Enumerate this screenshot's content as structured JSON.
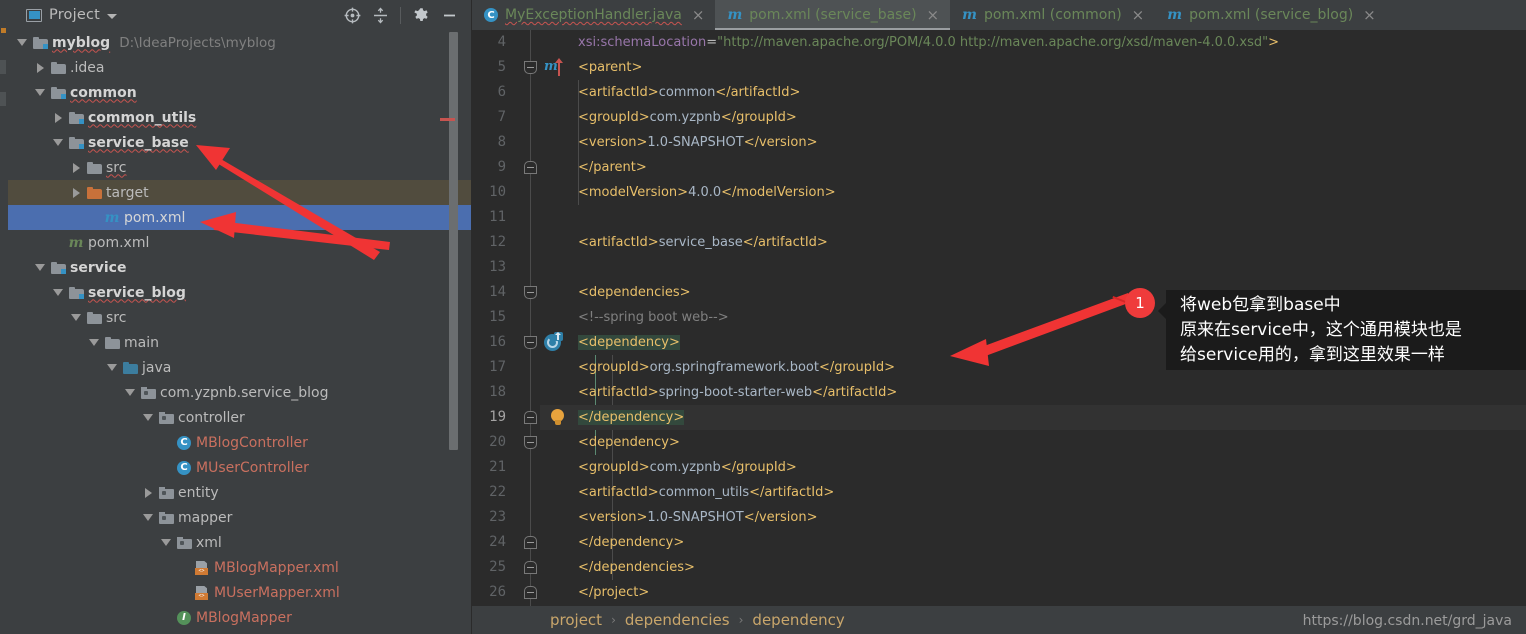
{
  "window": {
    "watermark": "https://blog.csdn.net/grd_java"
  },
  "project_panel": {
    "title": "Project",
    "icons": {
      "project": "project-window-icon",
      "chevron": "chevron-down-icon",
      "locate": "locate-target-icon",
      "collapse_all": "collapse-all-icon",
      "settings": "gear-icon",
      "minimize": "minimize-icon"
    },
    "tree": [
      {
        "label": "myblog",
        "sub": "D:\\IdeaProjects\\myblog",
        "indent": 0,
        "twisty": "down",
        "icon": "folder-module",
        "bold": true,
        "squiggle": true
      },
      {
        "label": ".idea",
        "sub": "",
        "indent": 1,
        "twisty": "right",
        "icon": "folder-plain",
        "bold": false,
        "squiggle": false
      },
      {
        "label": "common",
        "sub": "",
        "indent": 1,
        "twisty": "down",
        "icon": "folder-module",
        "bold": true,
        "squiggle": true
      },
      {
        "label": "common_utils",
        "sub": "",
        "indent": 2,
        "twisty": "right",
        "icon": "folder-module",
        "bold": true,
        "squiggle": true
      },
      {
        "label": "service_base",
        "sub": "",
        "indent": 2,
        "twisty": "down",
        "icon": "folder-module",
        "bold": true,
        "squiggle": true
      },
      {
        "label": "src",
        "sub": "",
        "indent": 3,
        "twisty": "right",
        "icon": "folder-plain",
        "bold": false,
        "squiggle": true
      },
      {
        "label": "target",
        "sub": "",
        "indent": 3,
        "twisty": "right",
        "icon": "folder-orange",
        "bold": false,
        "squiggle": false,
        "state": "excluded"
      },
      {
        "label": "pom.xml",
        "sub": "",
        "indent": 4,
        "twisty": "none",
        "icon": "maven-blue",
        "bold": false,
        "squiggle": false,
        "state": "selected"
      },
      {
        "label": "pom.xml",
        "sub": "",
        "indent": 2,
        "twisty": "none",
        "icon": "maven-green",
        "bold": false,
        "squiggle": false
      },
      {
        "label": "service",
        "sub": "",
        "indent": 1,
        "twisty": "down",
        "icon": "folder-module",
        "bold": true,
        "squiggle": false
      },
      {
        "label": "service_blog",
        "sub": "",
        "indent": 2,
        "twisty": "down",
        "icon": "folder-module",
        "bold": true,
        "squiggle": true
      },
      {
        "label": "src",
        "sub": "",
        "indent": 3,
        "twisty": "down",
        "icon": "folder-plain",
        "bold": false,
        "squiggle": false
      },
      {
        "label": "main",
        "sub": "",
        "indent": 4,
        "twisty": "down",
        "icon": "folder-plain",
        "bold": false,
        "squiggle": false
      },
      {
        "label": "java",
        "sub": "",
        "indent": 5,
        "twisty": "down",
        "icon": "folder-blue",
        "bold": false,
        "squiggle": false
      },
      {
        "label": "com.yzpnb.service_blog",
        "sub": "",
        "indent": 6,
        "twisty": "down",
        "icon": "package",
        "bold": false,
        "squiggle": false
      },
      {
        "label": "controller",
        "sub": "",
        "indent": 7,
        "twisty": "down",
        "icon": "package",
        "bold": false,
        "squiggle": false
      },
      {
        "label": "MBlogController",
        "sub": "",
        "indent": 8,
        "twisty": "none",
        "icon": "class",
        "bold": false,
        "squiggle": false,
        "state": "modified"
      },
      {
        "label": "MUserController",
        "sub": "",
        "indent": 8,
        "twisty": "none",
        "icon": "class",
        "bold": false,
        "squiggle": false,
        "state": "modified"
      },
      {
        "label": "entity",
        "sub": "",
        "indent": 7,
        "twisty": "right",
        "icon": "package",
        "bold": false,
        "squiggle": false
      },
      {
        "label": "mapper",
        "sub": "",
        "indent": 7,
        "twisty": "down",
        "icon": "package",
        "bold": false,
        "squiggle": false
      },
      {
        "label": "xml",
        "sub": "",
        "indent": 8,
        "twisty": "down",
        "icon": "package",
        "bold": false,
        "squiggle": false
      },
      {
        "label": "MBlogMapper.xml",
        "sub": "",
        "indent": 9,
        "twisty": "none",
        "icon": "xml-file",
        "bold": false,
        "squiggle": false,
        "state": "modified"
      },
      {
        "label": "MUserMapper.xml",
        "sub": "",
        "indent": 9,
        "twisty": "none",
        "icon": "xml-file",
        "bold": false,
        "squiggle": false,
        "state": "modified"
      },
      {
        "label": "MBlogMapper",
        "sub": "",
        "indent": 8,
        "twisty": "none",
        "icon": "interface",
        "bold": false,
        "squiggle": false,
        "state": "modified"
      }
    ]
  },
  "editor": {
    "tabs": [
      {
        "label": "MyExceptionHandler.java",
        "icon": "class",
        "active": false,
        "squiggle": true
      },
      {
        "label": "pom.xml (service_base)",
        "icon": "maven",
        "active": true,
        "squiggle": false
      },
      {
        "label": "pom.xml (common)",
        "icon": "maven",
        "active": false,
        "squiggle": false
      },
      {
        "label": "pom.xml (service_blog)",
        "icon": "maven",
        "active": false,
        "squiggle": false
      }
    ],
    "close_glyph": "×",
    "lines": [
      {
        "n": 4,
        "indent": 0,
        "fold": "",
        "current": false,
        "tokens": [
          {
            "t": "        ",
            "c": "txt"
          },
          {
            "t": "xsi:schemaLocation",
            "c": "attr"
          },
          {
            "t": "=",
            "c": "at"
          },
          {
            "t": "\"http://maven.apache.org/POM/4.0.0 http://maven.apache.org/xsd/maven-4.0.0.xsd\"",
            "c": "str"
          },
          {
            "t": ">",
            "c": "tg"
          }
        ]
      },
      {
        "n": 5,
        "indent": 0,
        "fold": "open",
        "current": false,
        "gutter": "maven-import",
        "tokens": [
          {
            "t": "    ",
            "c": "txt"
          },
          {
            "t": "<parent>",
            "c": "tg"
          }
        ]
      },
      {
        "n": 6,
        "indent": 0,
        "fold": "",
        "current": false,
        "tokens": [
          {
            "t": "        ",
            "c": "txt"
          },
          {
            "t": "<artifactId>",
            "c": "tg"
          },
          {
            "t": "common",
            "c": "txt"
          },
          {
            "t": "</artifactId>",
            "c": "tg"
          }
        ]
      },
      {
        "n": 7,
        "indent": 0,
        "fold": "",
        "current": false,
        "tokens": [
          {
            "t": "        ",
            "c": "txt"
          },
          {
            "t": "<groupId>",
            "c": "tg"
          },
          {
            "t": "com.yzpnb",
            "c": "txt"
          },
          {
            "t": "</groupId>",
            "c": "tg"
          }
        ]
      },
      {
        "n": 8,
        "indent": 0,
        "fold": "",
        "current": false,
        "tokens": [
          {
            "t": "        ",
            "c": "txt"
          },
          {
            "t": "<version>",
            "c": "tg"
          },
          {
            "t": "1.0-SNAPSHOT",
            "c": "txt"
          },
          {
            "t": "</version>",
            "c": "tg"
          }
        ]
      },
      {
        "n": 9,
        "indent": 0,
        "fold": "close",
        "current": false,
        "tokens": [
          {
            "t": "    ",
            "c": "txt"
          },
          {
            "t": "</parent>",
            "c": "tg"
          }
        ]
      },
      {
        "n": 10,
        "indent": 0,
        "fold": "",
        "current": false,
        "tokens": [
          {
            "t": "    ",
            "c": "txt"
          },
          {
            "t": "<modelVersion>",
            "c": "tg"
          },
          {
            "t": "4.0.0",
            "c": "txt"
          },
          {
            "t": "</modelVersion>",
            "c": "tg"
          }
        ]
      },
      {
        "n": 11,
        "indent": 0,
        "fold": "",
        "current": false,
        "tokens": []
      },
      {
        "n": 12,
        "indent": 0,
        "fold": "",
        "current": false,
        "tokens": [
          {
            "t": "    ",
            "c": "txt"
          },
          {
            "t": "<artifactId>",
            "c": "tg"
          },
          {
            "t": "service_base",
            "c": "txt"
          },
          {
            "t": "</artifactId>",
            "c": "tg"
          }
        ]
      },
      {
        "n": 13,
        "indent": 0,
        "fold": "",
        "current": false,
        "tokens": []
      },
      {
        "n": 14,
        "indent": 0,
        "fold": "open",
        "current": false,
        "tokens": [
          {
            "t": "    ",
            "c": "txt"
          },
          {
            "t": "<dependencies>",
            "c": "tg"
          }
        ]
      },
      {
        "n": 15,
        "indent": 0,
        "fold": "",
        "current": false,
        "tokens": [
          {
            "t": "        ",
            "c": "txt"
          },
          {
            "t": "<!--spring boot web-->",
            "c": "cm"
          }
        ]
      },
      {
        "n": 16,
        "indent": 0,
        "fold": "open",
        "current": false,
        "gutter": "reload",
        "tokens": [
          {
            "t": "        ",
            "c": "txt"
          },
          {
            "t": "<dependency>",
            "c": "tg hl-tag"
          }
        ]
      },
      {
        "n": 17,
        "indent": 0,
        "fold": "",
        "current": false,
        "tokens": [
          {
            "t": "            ",
            "c": "txt"
          },
          {
            "t": "<groupId>",
            "c": "tg"
          },
          {
            "t": "org.springframework.boot",
            "c": "txt"
          },
          {
            "t": "</groupId>",
            "c": "tg"
          }
        ]
      },
      {
        "n": 18,
        "indent": 0,
        "fold": "",
        "current": false,
        "tokens": [
          {
            "t": "            ",
            "c": "txt"
          },
          {
            "t": "<artifactId>",
            "c": "tg"
          },
          {
            "t": "spring-boot-starter-web",
            "c": "txt"
          },
          {
            "t": "</artifactId>",
            "c": "tg"
          }
        ]
      },
      {
        "n": 19,
        "indent": 0,
        "fold": "close",
        "current": true,
        "gutter": "bulb",
        "tokens": [
          {
            "t": "        ",
            "c": "txt"
          },
          {
            "t": "</dependency>",
            "c": "tg hl-tag"
          }
        ]
      },
      {
        "n": 20,
        "indent": 0,
        "fold": "open",
        "current": false,
        "tokens": [
          {
            "t": "        ",
            "c": "txt"
          },
          {
            "t": "<dependency>",
            "c": "tg"
          }
        ]
      },
      {
        "n": 21,
        "indent": 0,
        "fold": "",
        "current": false,
        "tokens": [
          {
            "t": "            ",
            "c": "txt"
          },
          {
            "t": "<groupId>",
            "c": "tg"
          },
          {
            "t": "com.yzpnb",
            "c": "txt"
          },
          {
            "t": "</groupId>",
            "c": "tg"
          }
        ]
      },
      {
        "n": 22,
        "indent": 0,
        "fold": "",
        "current": false,
        "tokens": [
          {
            "t": "            ",
            "c": "txt"
          },
          {
            "t": "<artifactId>",
            "c": "tg"
          },
          {
            "t": "common_utils",
            "c": "txt"
          },
          {
            "t": "</artifactId>",
            "c": "tg"
          }
        ]
      },
      {
        "n": 23,
        "indent": 0,
        "fold": "",
        "current": false,
        "tokens": [
          {
            "t": "            ",
            "c": "txt"
          },
          {
            "t": "<version>",
            "c": "tg"
          },
          {
            "t": "1.0-SNAPSHOT",
            "c": "txt"
          },
          {
            "t": "</version>",
            "c": "tg"
          }
        ]
      },
      {
        "n": 24,
        "indent": 0,
        "fold": "close",
        "current": false,
        "tokens": [
          {
            "t": "        ",
            "c": "txt"
          },
          {
            "t": "</dependency>",
            "c": "tg"
          }
        ]
      },
      {
        "n": 25,
        "indent": 0,
        "fold": "close",
        "current": false,
        "tokens": [
          {
            "t": "    ",
            "c": "txt"
          },
          {
            "t": "</dependencies>",
            "c": "tg"
          }
        ]
      },
      {
        "n": 26,
        "indent": 0,
        "fold": "close",
        "current": false,
        "tokens": [
          {
            "t": "</project>",
            "c": "tg"
          }
        ]
      }
    ],
    "breadcrumb": [
      "project",
      "dependencies",
      "dependency"
    ],
    "breadcrumb_separator": "›"
  },
  "annotation": {
    "badge": "1",
    "lines": [
      "将web包拿到base中",
      "原来在service中，这个通用模块也是",
      "给service用的，拿到这里效果一样"
    ],
    "arrow_color": "#f03434"
  },
  "colors": {
    "panel_bg": "#3c3f41",
    "editor_bg": "#2b2b2b",
    "selection_blue": "#4b6eaf",
    "excluded_olive": "#514c3e",
    "tag_amber": "#e8bf6a",
    "string_green": "#6a8759",
    "modified_red": "#c9705f",
    "annotation_red": "#ef3b3b"
  }
}
